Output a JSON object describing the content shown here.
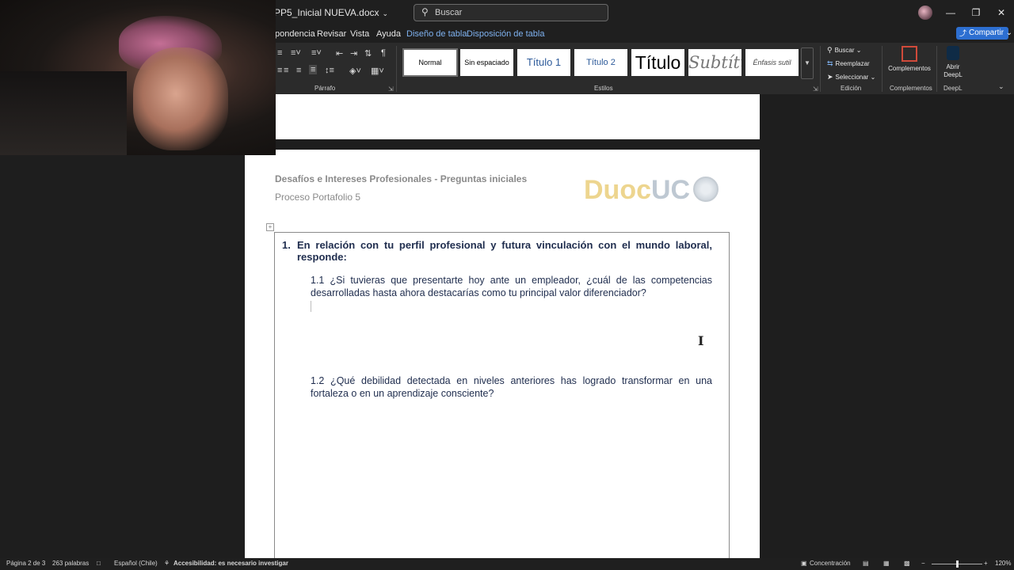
{
  "titlebar": {
    "doc_title": "PP5_Inicial NUEVA.docx",
    "search_placeholder": "Buscar",
    "window_controls": [
      "minimize-icon",
      "restore-icon",
      "close-icon"
    ]
  },
  "menu": {
    "tabs": [
      "pondencia",
      "Revisar",
      "Vista",
      "Ayuda",
      "Diseño de tabla",
      "Disposición de tabla"
    ],
    "share_label": "Compartir",
    "context_color": "#7fb2f0"
  },
  "ribbon": {
    "paragraph_group_label": "Párrafo",
    "styles_group_label": "Estilos",
    "styles": [
      "Normal",
      "Sin espaciado",
      "Título 1",
      "Título 2",
      "Título",
      "Subtítu",
      "Énfasis sutil"
    ],
    "edit_group_label": "Edición",
    "edit_items": [
      "Buscar",
      "Reemplazar",
      "Seleccionar"
    ],
    "complements_label": "Complementos",
    "complements_group_label": "Complementos",
    "deepl_label": "Abrir DeepL",
    "deepl_group_label": "DeepL"
  },
  "document": {
    "header_title": "Desafíos e Intereses Profesionales - Preguntas iniciales",
    "header_sub": "Proceso Portafolio 5",
    "logo_text_a": "Duoc",
    "logo_text_b": "UC",
    "q1_number": "1.",
    "q1_text": "En relación con tu perfil profesional y futura vinculación con el mundo laboral, responde:",
    "q1_1": "1.1 ¿Si tuvieras que presentarte hoy ante un empleador, ¿cuál de las competencias desarrolladas hasta ahora destacarías como tu principal valor diferenciador?",
    "q1_2": "1.2 ¿Qué debilidad detectada en niveles anteriores has logrado transformar en una fortaleza o en un aprendizaje consciente?",
    "heading_color": "#1f2d4e"
  },
  "statusbar": {
    "page": "Página 2 de 3",
    "words": "263 palabras",
    "language": "Español (Chile)",
    "accessibility": "Accesibilidad: es necesario investigar",
    "focus": "Concentración",
    "zoom": "120%",
    "zoom_fraction": 0.5
  }
}
